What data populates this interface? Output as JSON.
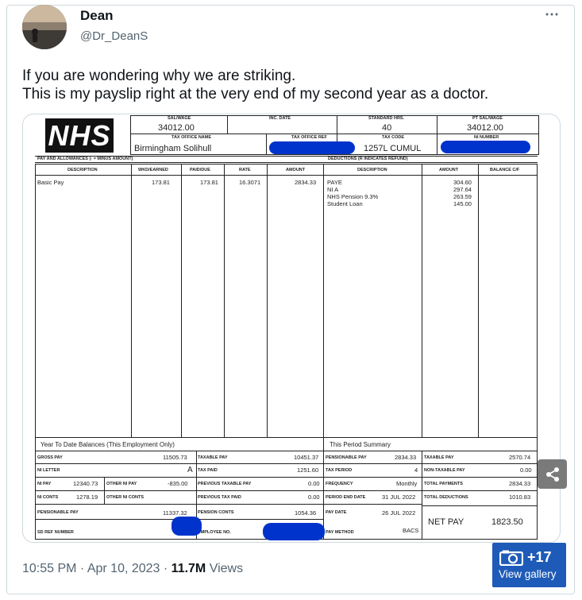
{
  "tweet": {
    "author_name": "Dean",
    "author_handle": "@Dr_DeanS",
    "more_icon": "⋯",
    "text_line1": "If you are wondering why we are striking.",
    "text_line2": "This is my payslip right at the very end of my second year as a doctor.",
    "timestamp": "10:55 PM · Apr 10, 2023 · ",
    "views_count": "11.7M",
    "views_label": " Views",
    "gallery_count": "+17",
    "gallery_label": "View gallery"
  },
  "payslip": {
    "logo": "NHS",
    "top": {
      "sal_wage_label": "SAL/WAGE",
      "sal_wage": "34012.00",
      "inc_date_label": "INC. DATE",
      "std_hrs_label": "STANDARD HRS.",
      "std_hrs": "40",
      "pt_sal_label": "PT SAL/WAGE",
      "pt_sal": "34012.00",
      "tax_office_name_label": "TAX OFFICE NAME",
      "tax_office_name": "Birmingham Solihull",
      "tax_office_ref_label": "TAX OFFICE REF",
      "tax_code_label": "TAX CODE",
      "tax_code": "1257L CUMUL",
      "ni_number_label": "NI NUMBER"
    },
    "pay_section_label": "PAY AND ALLOWANCES (- = MINUS AMOUNT)",
    "ded_section_label": "DEDUCTIONS (R INDICATES REFUND)",
    "pay_cols": [
      "DESCRIPTION",
      "WKD/EARNED",
      "PAID/DUE",
      "RATE",
      "AMOUNT"
    ],
    "pay_row": {
      "desc": "Basic Pay",
      "wkd": "173.81",
      "paid": "173.81",
      "rate": "16.3071",
      "amount": "2834.33"
    },
    "ded_cols": [
      "DESCRIPTION",
      "AMOUNT",
      "BALANCE C/F"
    ],
    "deductions": [
      {
        "desc": "PAYE",
        "amount": "304.60"
      },
      {
        "desc": "NI A",
        "amount": "297.64"
      },
      {
        "desc": "NHS Pension 9.3%",
        "amount": "263.59"
      },
      {
        "desc": "Student Loan",
        "amount": "145.00"
      }
    ],
    "ytd_title": "Year To Date Balances (This Employment Only)",
    "period_title": "This Period Summary",
    "ytd": {
      "gross_pay_label": "GROSS PAY",
      "gross_pay": "11505.73",
      "taxable_pay_label": "TAXABLE PAY",
      "taxable_pay": "10451.37",
      "ni_letter_label": "NI LETTER",
      "ni_letter": "A",
      "tax_paid_label": "TAX PAID",
      "tax_paid": "1251.60",
      "ni_pay_label": "NI PAY",
      "ni_pay": "12340.73",
      "other_ni_pay_label": "OTHER NI PAY",
      "other_ni_pay": "-835.00",
      "prev_taxable_label": "PREVIOUS TAXABLE PAY",
      "prev_taxable": "0.00",
      "ni_conts_label": "NI CONTS",
      "ni_conts": "1278.19",
      "other_ni_conts_label": "OTHER NI CONTS",
      "prev_tax_label": "PREVIOUS TAX PAID",
      "prev_tax": "0.00",
      "pensionable_label": "PENSIONABLE PAY",
      "pensionable": "11337.32",
      "pension_conts_label": "PENSION CONTS",
      "pension_conts": "1054.36",
      "sd_ref_label": "SD REF NUMBER",
      "employee_no_label": "EMPLOYEE NO."
    },
    "period": {
      "pensionable_label": "PENSIONABLE PAY",
      "pensionable": "2834.33",
      "taxable_label": "TAXABLE PAY",
      "taxable": "2570.74",
      "tax_period_label": "TAX PERIOD",
      "tax_period": "4",
      "non_taxable_label": "NON-TAXABLE PAY",
      "non_taxable": "0.00",
      "frequency_label": "FREQUENCY",
      "frequency": "Monthly",
      "total_payments_label": "TOTAL PAYMENTS",
      "total_payments": "2834.33",
      "period_end_label": "PERIOD END DATE",
      "period_end": "31 JUL 2022",
      "total_deductions_label": "TOTAL DEDUCTIONS",
      "total_deductions": "1010.83",
      "pay_date_label": "PAY DATE",
      "pay_date": "26 JUL 2022",
      "pay_method_label": "PAY METHOD",
      "pay_method": "BACS",
      "net_pay_label": "NET PAY",
      "net_pay": "1823.50"
    }
  },
  "colors": {
    "redaction": "#0033cc",
    "gallery_button": "#1e5bb8",
    "muted_text": "#536471"
  }
}
